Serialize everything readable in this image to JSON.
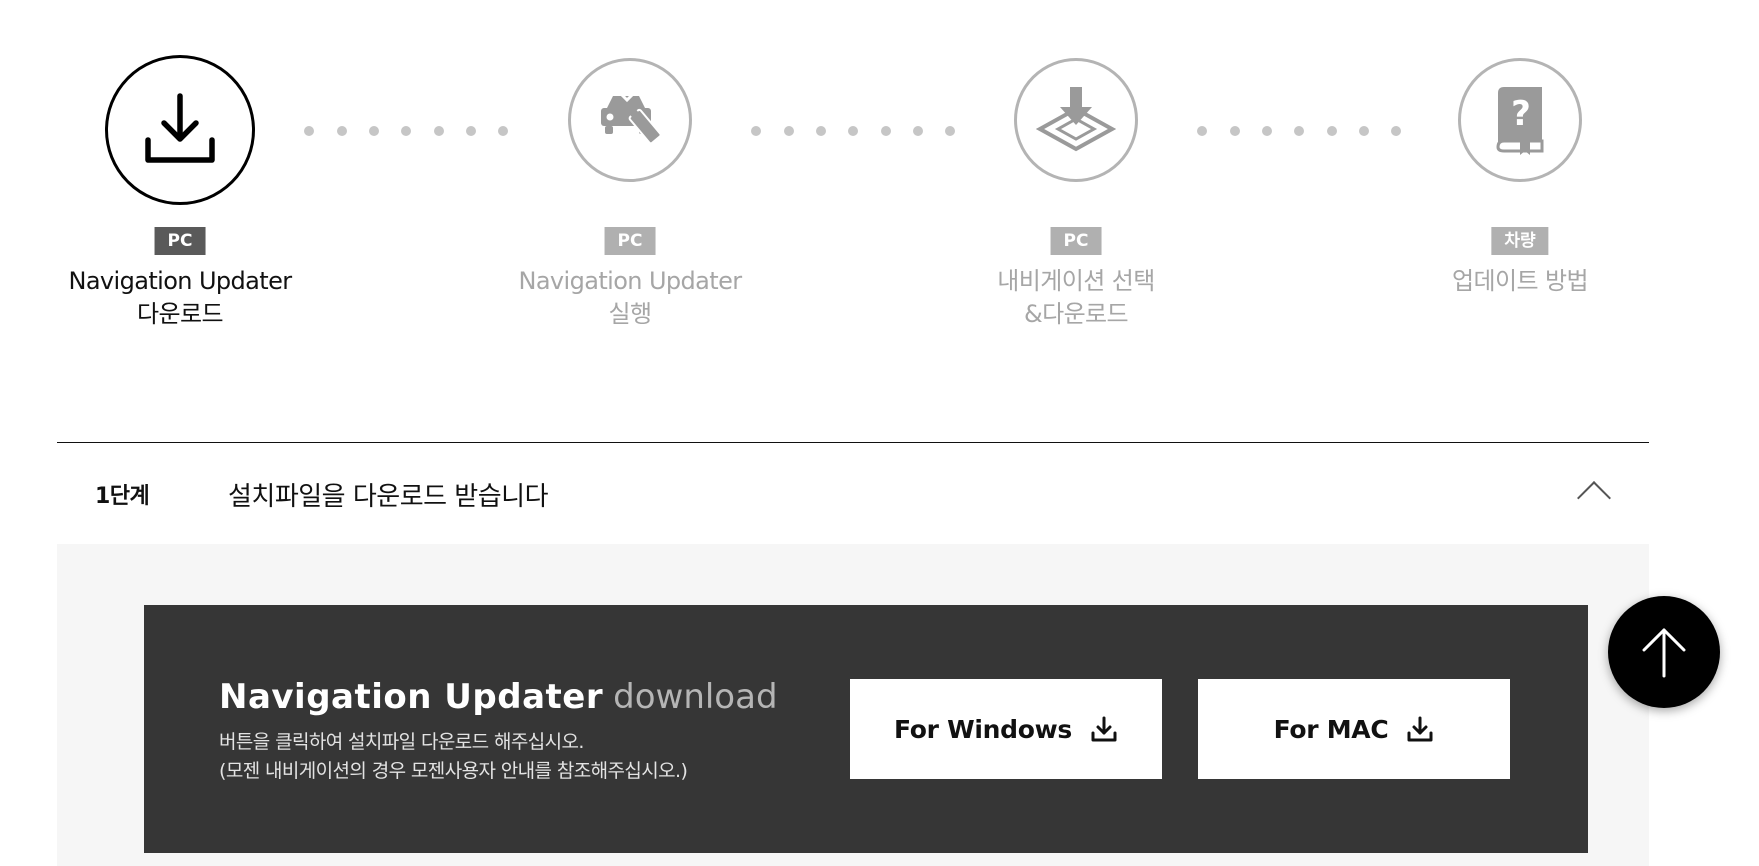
{
  "steps": [
    {
      "badge": "PC",
      "line1": "Navigation Updater",
      "line2": "다운로드",
      "icon": "download-icon",
      "active": true
    },
    {
      "badge": "PC",
      "line1": "Navigation Updater",
      "line2": "실행",
      "icon": "car-usb-icon",
      "active": false
    },
    {
      "badge": "PC",
      "line1": "내비게이션 선택",
      "line2": "&다운로드",
      "icon": "map-download-icon",
      "active": false
    },
    {
      "badge": "차량",
      "line1": "업데이트 방법",
      "line2": "",
      "icon": "help-book-icon",
      "active": false
    }
  ],
  "accordion": {
    "stage": "1단계",
    "title": "설치파일을 다운로드 받습니다",
    "toggle_icon": "chevron-up-icon"
  },
  "download": {
    "title_bold": "Navigation Updater",
    "title_light": "download",
    "desc_line1": "버튼을 클릭하여 설치파일 다운로드 해주십시오.",
    "desc_line2": "(모젠 내비게이션의 경우 모젠사용자 안내를 참조해주십시오.)",
    "windows_label": "For Windows",
    "mac_label": "For MAC"
  },
  "scroll_top_icon": "arrow-up-icon",
  "colors": {
    "active": "#000000",
    "inactive": "#b4b4b4",
    "panel_bg": "#f6f6f6",
    "dark_box": "#363636",
    "badge_active": "#5a5a5a",
    "badge_inactive": "#b0b0b0"
  }
}
